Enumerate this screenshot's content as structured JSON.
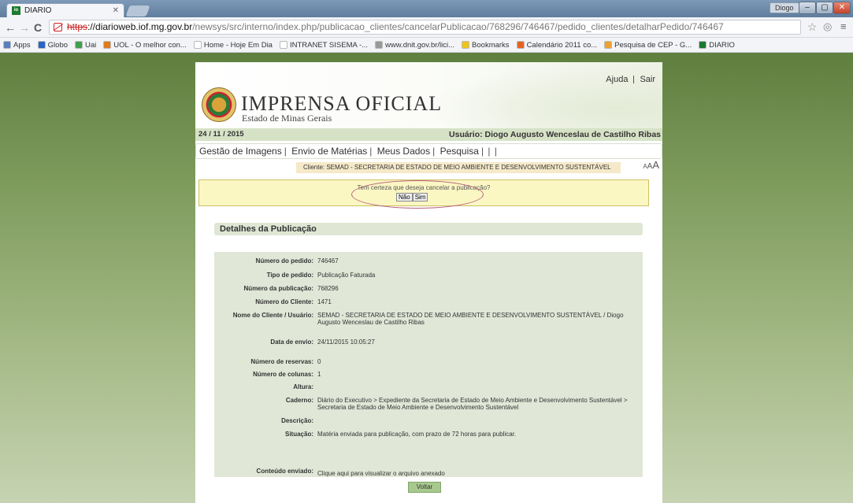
{
  "browser": {
    "tab_title": "DIARIO",
    "tab_favicon_text": "io",
    "window_user": "Diogo",
    "url_protocol": "https",
    "url_domain": "://diarioweb.iof.mg.gov.br",
    "url_path": "/newsys/src/interno/index.php/publicacao_clientes/cancelarPublicacao/768296/746467/pedido_clientes/detalharPedido/746467",
    "bookmarks": [
      {
        "label": "Apps",
        "color": "#5b7fbd"
      },
      {
        "label": "Globo",
        "color": "#2a64c4"
      },
      {
        "label": "Uai",
        "color": "#3fa14b"
      },
      {
        "label": "UOL - O melhor con...",
        "color": "#e07b1a"
      },
      {
        "label": "Home - Hoje Em Dia",
        "color": "#ffffff"
      },
      {
        "label": "INTRANET SISEMA -...",
        "color": "#ffffff"
      },
      {
        "label": "www.dnit.gov.br/lici...",
        "color": "#999999"
      },
      {
        "label": "Bookmarks",
        "color": "#f0c419"
      },
      {
        "label": "Calendário 2011 co...",
        "color": "#e8621f"
      },
      {
        "label": "Pesquisa de CEP - G...",
        "color": "#f0a030"
      },
      {
        "label": "DIARIO",
        "color": "#1b7a2e"
      }
    ]
  },
  "site": {
    "title": "IMPRENSA OFICIAL",
    "subtitle": "Estado de Minas Gerais",
    "help_link": "Ajuda",
    "logout_link": "Sair",
    "date": "24 / 11 / 2015",
    "user": "Usuário: Diogo Augusto Wenceslau de Castilho Ribas",
    "menu": [
      "Gestão de Imagens",
      "Envio de Matérias",
      "Meus Dados",
      "Pesquisa"
    ],
    "client": "Cliente: SEMAD - SECRETARIA DE ESTADO DE MEIO AMBIENTE E DESENVOLVIMENTO SUSTENTÁVEL",
    "font_sizes": [
      "A",
      "A",
      "A"
    ]
  },
  "confirm": {
    "message": "Tem certeza que deseja cancelar a publicação?",
    "no_label": "Não",
    "yes_label": "Sim"
  },
  "details": {
    "section_title": "Detalhes da Publicação",
    "rows": [
      {
        "label": "Número do pedido:",
        "value": "746467"
      },
      {
        "label": "Tipo de pedido:",
        "value": "Publicação Faturada"
      },
      {
        "label": "Número da publicação:",
        "value": "768296"
      },
      {
        "label": "Número do Cliente:",
        "value": "1471"
      },
      {
        "label": "Nome do Cliente / Usuário:",
        "value": "SEMAD - SECRETARIA DE ESTADO DE MEIO AMBIENTE E DESENVOLVIMENTO SUSTENTÁVEL / Diogo Augusto Wenceslau de Castilho Ribas"
      },
      {
        "label": "Data de envio:",
        "value": "24/11/2015 10:05:27"
      },
      {
        "label": "Número de reservas:",
        "value": "0"
      },
      {
        "label": "Número de colunas:",
        "value": "1"
      },
      {
        "label": "Altura:",
        "value": ""
      },
      {
        "label": "Caderno:",
        "value": "Diário do Executivo > Expediente da Secretaria de Estado de Meio Ambiente e Desenvolvimento Sustentável > Secretaria de Estado de Meio Ambiente e Desenvolvimento Sustentável"
      },
      {
        "label": "Descrição:",
        "value": ""
      },
      {
        "label": "Situação:",
        "value": "Matéria enviada para publicação, com prazo de 72 horas para publicar."
      },
      {
        "label": "Conteúdo enviado:",
        "value": ""
      }
    ],
    "attachment_link": "Clique aqui para visualizar o arquivo anexado",
    "back_button": "Voltar"
  }
}
